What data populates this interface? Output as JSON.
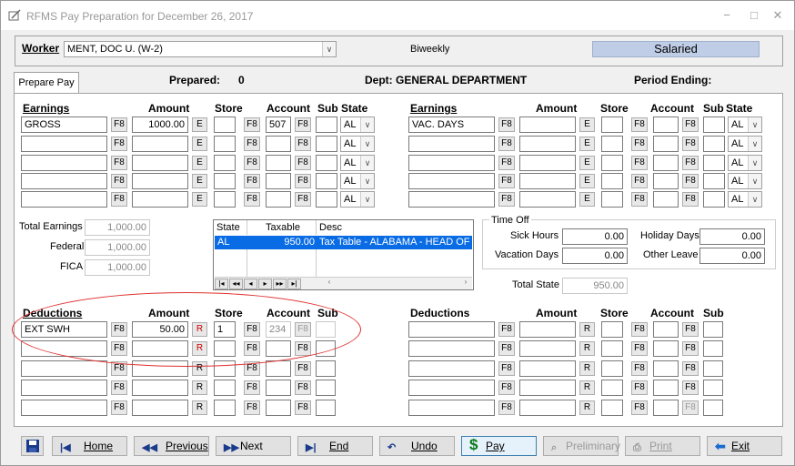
{
  "window": {
    "title": "RFMS Pay Preparation for December 26, 2017"
  },
  "header": {
    "worker_label": "Worker",
    "worker_value": "MENT, DOC U. (W-2)",
    "frequency": "Biweekly",
    "pay_type": "Salaried",
    "prepared_label": "Prepared:",
    "prepared_value": "0",
    "dept_label": "Dept: GENERAL DEPARTMENT",
    "period_label": "Period Ending:"
  },
  "tab": {
    "label": "Prepare Pay"
  },
  "earnings": {
    "headers": {
      "earnings": "Earnings",
      "amount": "Amount",
      "store": "Store",
      "account": "Account",
      "sub": "Sub",
      "state": "State"
    },
    "left_rows": [
      {
        "code": "GROSS",
        "amount": "1000.00",
        "store": "",
        "account": "507",
        "sub": "",
        "state": "AL"
      },
      {
        "code": "",
        "amount": "",
        "store": "",
        "account": "",
        "sub": "",
        "state": "AL"
      },
      {
        "code": "",
        "amount": "",
        "store": "",
        "account": "",
        "sub": "",
        "state": "AL"
      },
      {
        "code": "",
        "amount": "",
        "store": "",
        "account": "",
        "sub": "",
        "state": "AL"
      },
      {
        "code": "",
        "amount": "",
        "store": "",
        "account": "",
        "sub": "",
        "state": "AL"
      }
    ],
    "right_rows": [
      {
        "code": "VAC. DAYS",
        "amount": "",
        "store": "",
        "account": "",
        "sub": "",
        "state": "AL"
      },
      {
        "code": "",
        "amount": "",
        "store": "",
        "account": "",
        "sub": "",
        "state": "AL"
      },
      {
        "code": "",
        "amount": "",
        "store": "",
        "account": "",
        "sub": "",
        "state": "AL"
      },
      {
        "code": "",
        "amount": "",
        "store": "",
        "account": "",
        "sub": "",
        "state": "AL"
      },
      {
        "code": "",
        "amount": "",
        "store": "",
        "account": "",
        "sub": "",
        "state": "AL"
      }
    ],
    "f8": "F8",
    "e": "E"
  },
  "totals": {
    "total_earnings_label": "Total Earnings",
    "total_earnings": "1,000.00",
    "federal_label": "Federal",
    "federal": "1,000.00",
    "fica_label": "FICA",
    "fica": "1,000.00"
  },
  "state_grid": {
    "columns": [
      "State",
      "Taxable",
      "Desc"
    ],
    "row": {
      "state": "AL",
      "taxable": "950.00",
      "desc": "Tax Table - ALABAMA - HEAD OF H"
    },
    "nav": [
      "|◂",
      "◂◂",
      "◂",
      "▸",
      "▸▸",
      "▸|"
    ]
  },
  "time_off": {
    "legend": "Time Off",
    "sick_label": "Sick Hours",
    "sick": "0.00",
    "holiday_label": "Holiday Days",
    "holiday": "0.00",
    "vacation_label": "Vacation Days",
    "vacation": "0.00",
    "other_label": "Other Leave",
    "other": "0.00"
  },
  "total_state": {
    "label": "Total State",
    "value": "950.00"
  },
  "deductions": {
    "headers": {
      "deductions": "Deductions",
      "amount": "Amount",
      "store": "Store",
      "account": "Account",
      "sub": "Sub"
    },
    "left_rows": [
      {
        "code": "EXT SWH",
        "amount": "50.00",
        "store": "1",
        "account": "234",
        "sub": ""
      },
      {
        "code": "",
        "amount": "",
        "store": "",
        "account": "",
        "sub": ""
      },
      {
        "code": "",
        "amount": "",
        "store": "",
        "account": "",
        "sub": ""
      },
      {
        "code": "",
        "amount": "",
        "store": "",
        "account": "",
        "sub": ""
      },
      {
        "code": "",
        "amount": "",
        "store": "",
        "account": "",
        "sub": ""
      }
    ],
    "right_rows": [
      {
        "code": "",
        "amount": "",
        "store": "",
        "account": "",
        "sub": ""
      },
      {
        "code": "",
        "amount": "",
        "store": "",
        "account": "",
        "sub": ""
      },
      {
        "code": "",
        "amount": "",
        "store": "",
        "account": "",
        "sub": ""
      },
      {
        "code": "",
        "amount": "",
        "store": "",
        "account": "",
        "sub": ""
      },
      {
        "code": "",
        "amount": "",
        "store": "",
        "account": "",
        "sub": ""
      }
    ],
    "r": "R"
  },
  "toolbar": {
    "home": "Home",
    "previous": "Previous",
    "next": "Next",
    "end": "End",
    "undo": "Undo",
    "pay": "Pay",
    "preliminary": "Preliminary",
    "print": "Print",
    "exit": "Exit"
  },
  "colors": {
    "selection": "#0a6ce5",
    "salaried_badge": "#bfcde6",
    "highlight_ellipse": "#e03030"
  }
}
